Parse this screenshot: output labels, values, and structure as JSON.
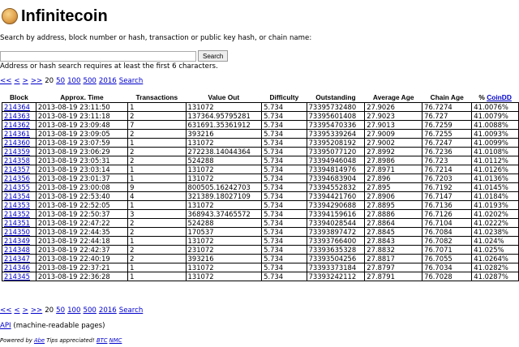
{
  "header": {
    "title": "Infinitecoin"
  },
  "search": {
    "description": "Search by address, block number or hash, transaction or public key hash, or chain name:",
    "input_value": "",
    "button_label": "Search",
    "hint": "Address or hash search requires at least the first 6 characters."
  },
  "pager": {
    "first": "<<",
    "prev": "<",
    "next": ">",
    "last": ">>",
    "current": "20",
    "sizes": [
      "50",
      "100",
      "500",
      "2016"
    ],
    "search_link": "Search"
  },
  "table": {
    "headers": [
      "Block",
      "Approx. Time",
      "Transactions",
      "Value Out",
      "Difficulty",
      "Outstanding",
      "Average Age",
      "Chain Age",
      "% ",
      "CoinDD"
    ],
    "rows": [
      [
        "214364",
        "2013-08-19 23:11:50",
        "1",
        "131072",
        "5.734",
        "73395732480",
        "27.9026",
        "76.7274",
        "41.0076%"
      ],
      [
        "214363",
        "2013-08-19 23:11:18",
        "2",
        "137364.95795281",
        "5.734",
        "73395601408",
        "27.9023",
        "76.727",
        "41.0079%"
      ],
      [
        "214362",
        "2013-08-19 23:09:48",
        "7",
        "631691.35361912",
        "5.734",
        "73395470336",
        "27.9013",
        "76.7259",
        "41.0088%"
      ],
      [
        "214361",
        "2013-08-19 23:09:05",
        "2",
        "393216",
        "5.734",
        "73395339264",
        "27.9009",
        "76.7255",
        "41.0093%"
      ],
      [
        "214360",
        "2013-08-19 23:07:59",
        "1",
        "131072",
        "5.734",
        "73395208192",
        "27.9002",
        "76.7247",
        "41.0099%"
      ],
      [
        "214359",
        "2013-08-19 23:06:29",
        "2",
        "272238.14044364",
        "5.734",
        "73395077120",
        "27.8992",
        "76.7236",
        "41.0108%"
      ],
      [
        "214358",
        "2013-08-19 23:05:31",
        "2",
        "524288",
        "5.734",
        "73394946048",
        "27.8986",
        "76.723",
        "41.0112%"
      ],
      [
        "214357",
        "2013-08-19 23:03:14",
        "1",
        "131072",
        "5.734",
        "73394814976",
        "27.8971",
        "76.7214",
        "41.0126%"
      ],
      [
        "214356",
        "2013-08-19 23:01:37",
        "1",
        "131072",
        "5.734",
        "73394683904",
        "27.896",
        "76.7203",
        "41.0136%"
      ],
      [
        "214355",
        "2013-08-19 23:00:08",
        "9",
        "800505.16242703",
        "5.734",
        "73394552832",
        "27.895",
        "76.7192",
        "41.0145%"
      ],
      [
        "214354",
        "2013-08-19 22:53:40",
        "4",
        "321389.18027109",
        "5.734",
        "73394421760",
        "27.8906",
        "76.7147",
        "41.0184%"
      ],
      [
        "214353",
        "2013-08-19 22:52:05",
        "1",
        "131072",
        "5.734",
        "73394290688",
        "27.8895",
        "76.7136",
        "41.0193%"
      ],
      [
        "214352",
        "2013-08-19 22:50:37",
        "3",
        "368943.37465572",
        "5.734",
        "73394159616",
        "27.8886",
        "76.7126",
        "41.0202%"
      ],
      [
        "214351",
        "2013-08-19 22:47:22",
        "2",
        "524288",
        "5.734",
        "73394028544",
        "27.8864",
        "76.7104",
        "41.0222%"
      ],
      [
        "214350",
        "2013-08-19 22:44:35",
        "2",
        "170537",
        "5.734",
        "73393897472",
        "27.8845",
        "76.7084",
        "41.0238%"
      ],
      [
        "214349",
        "2013-08-19 22:44:18",
        "1",
        "131072",
        "5.734",
        "73393766400",
        "27.8843",
        "76.7082",
        "41.024%"
      ],
      [
        "214348",
        "2013-08-19 22:42:37",
        "2",
        "231072",
        "5.734",
        "73393635328",
        "27.8832",
        "76.7071",
        "41.025%"
      ],
      [
        "214347",
        "2013-08-19 22:40:19",
        "2",
        "393216",
        "5.734",
        "73393504256",
        "27.8817",
        "76.7055",
        "41.0264%"
      ],
      [
        "214346",
        "2013-08-19 22:37:21",
        "1",
        "131072",
        "5.734",
        "73393373184",
        "27.8797",
        "76.7034",
        "41.0282%"
      ],
      [
        "214345",
        "2013-08-19 22:36:28",
        "1",
        "131072",
        "5.734",
        "73393242112",
        "27.8791",
        "76.7028",
        "41.0287%"
      ]
    ]
  },
  "api": {
    "link": "API",
    "text": " (machine-readable pages)"
  },
  "footer": {
    "prefix": "Powered by ",
    "abe": "Abe",
    "middle": " Tips appreciated! ",
    "btc": "BTC",
    "nmc": "NMC"
  }
}
